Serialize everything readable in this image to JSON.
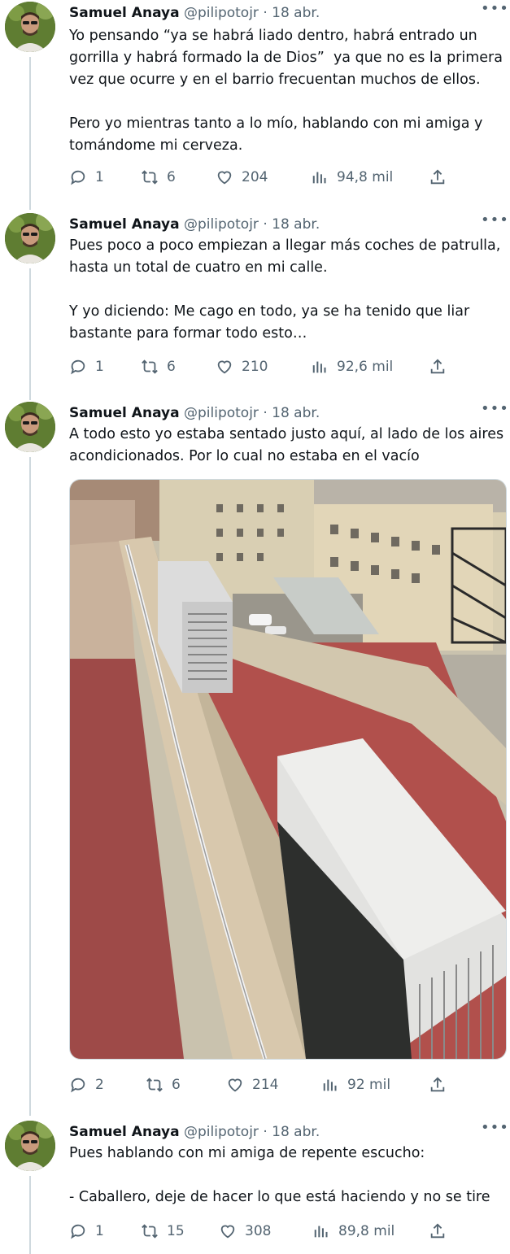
{
  "tweets": [
    {
      "author": {
        "name": "Samuel Anaya",
        "handle": "@pilipotojr",
        "date": "18 abr."
      },
      "text": "Yo pensando “ya se habrá liado dentro, habrá entrado un gorrilla y habrá formado la de Dios”  ya que no es la primera vez que ocurre y en el barrio frecuentan muchos de ellos.\n\nPero yo mientras tanto a lo mío, hablando con mi amiga y tomándome mi cerveza.",
      "stats": {
        "replies": "1",
        "retweets": "6",
        "likes": "204",
        "views": "94,8 mil"
      }
    },
    {
      "author": {
        "name": "Samuel Anaya",
        "handle": "@pilipotojr",
        "date": "18 abr."
      },
      "text": "Pues poco a poco empiezan a llegar más coches de patrulla, hasta un total de cuatro en mi calle.\n\nY yo diciendo: Me cago en todo, ya se ha tenido que liar bastante para formar todo esto…",
      "stats": {
        "replies": "1",
        "retweets": "6",
        "likes": "210",
        "views": "92,6 mil"
      }
    },
    {
      "author": {
        "name": "Samuel Anaya",
        "handle": "@pilipotojr",
        "date": "18 abr."
      },
      "text": "A todo esto yo estaba sentado justo aquí, al lado de los aires acondicionados. Por lo cual no estaba en el vacío",
      "stats": {
        "replies": "2",
        "retweets": "6",
        "likes": "214",
        "views": "92 mil"
      }
    },
    {
      "author": {
        "name": "Samuel Anaya",
        "handle": "@pilipotojr",
        "date": "18 abr."
      },
      "text": "Pues hablando con mi amiga de repente escucho:\n\n- Caballero, deje de hacer lo que está haciendo y no se tire",
      "stats": {
        "replies": "1",
        "retweets": "15",
        "likes": "308",
        "views": "89,8 mil"
      }
    }
  ],
  "ui": {
    "separator": "·",
    "more": "•••"
  },
  "icons": [
    "reply-icon",
    "retweet-icon",
    "like-icon",
    "views-icon",
    "share-icon",
    "more-icon"
  ],
  "colors": {
    "text": "#0f1419",
    "secondary": "#536471",
    "line": "#cfd9de"
  }
}
